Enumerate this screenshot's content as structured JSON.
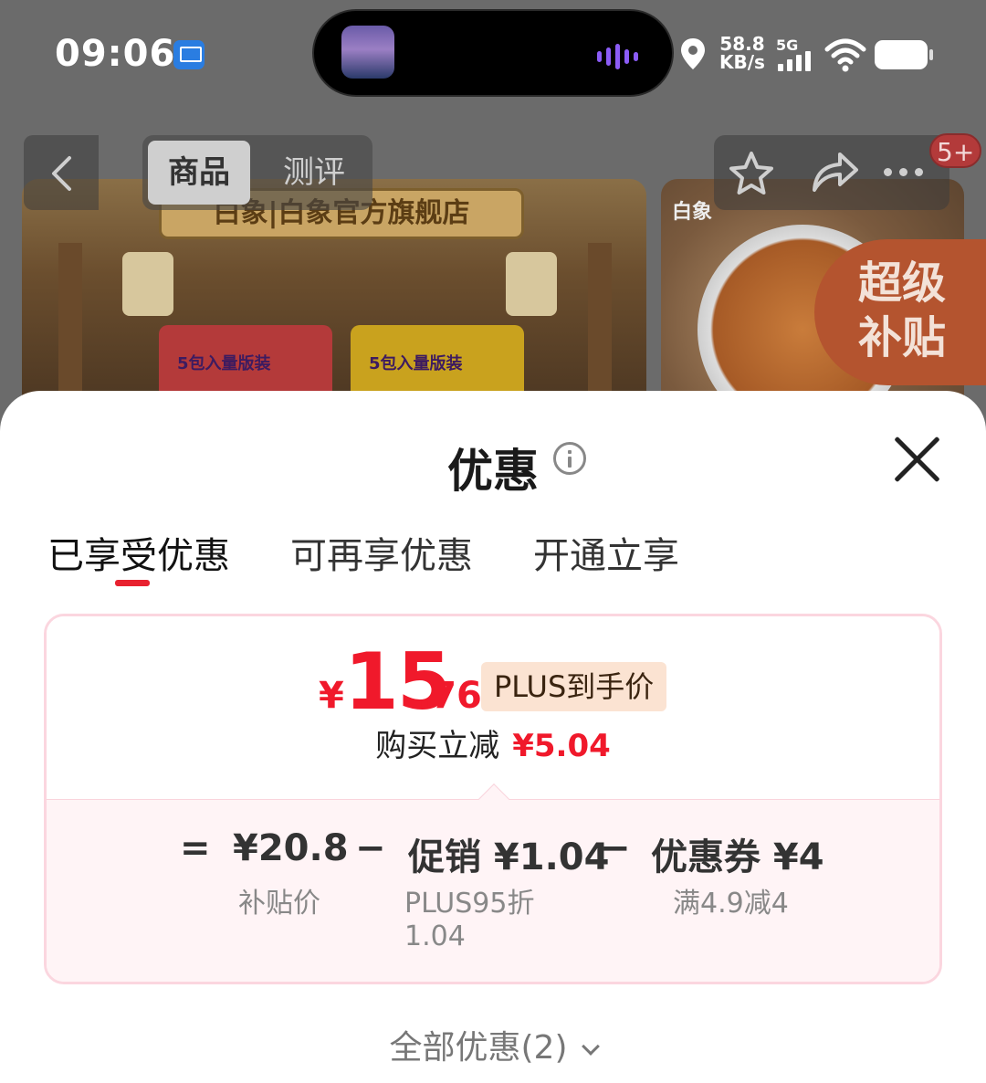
{
  "status_bar": {
    "time": "09:06",
    "net_speed_value": "58.8",
    "net_speed_unit": "KB/s",
    "network_type": "5G"
  },
  "top_nav": {
    "tabs": [
      "商品",
      "测评"
    ],
    "cart_badge": "5+"
  },
  "banner": {
    "shop_name": "白象|白象官方旗舰店",
    "pack_label_1": "5包入量版装",
    "pack_label_2": "5包入量版装",
    "brand_small": "白象",
    "super_subsidy": [
      "超级",
      "补贴"
    ]
  },
  "sheet": {
    "title": "优惠",
    "tabs": [
      "已享受优惠",
      "可再享优惠",
      "开通立享"
    ],
    "price": {
      "currency": "¥",
      "integer": "15",
      "decimal": ".76",
      "tag": "PLUS到手价"
    },
    "reduce_label": "购买立减",
    "reduce_amount": "¥5.04",
    "formula": {
      "equals": "=",
      "base_value": "¥20.8",
      "base_label": "补贴价",
      "minus": "−",
      "promo_value": "促销 ¥1.04",
      "promo_label_line1": "PLUS95折",
      "promo_label_line2": "1.04",
      "coupon_value": "优惠券 ¥4",
      "coupon_label": "满4.9减4"
    },
    "all_offers": "全部优惠(2)"
  }
}
